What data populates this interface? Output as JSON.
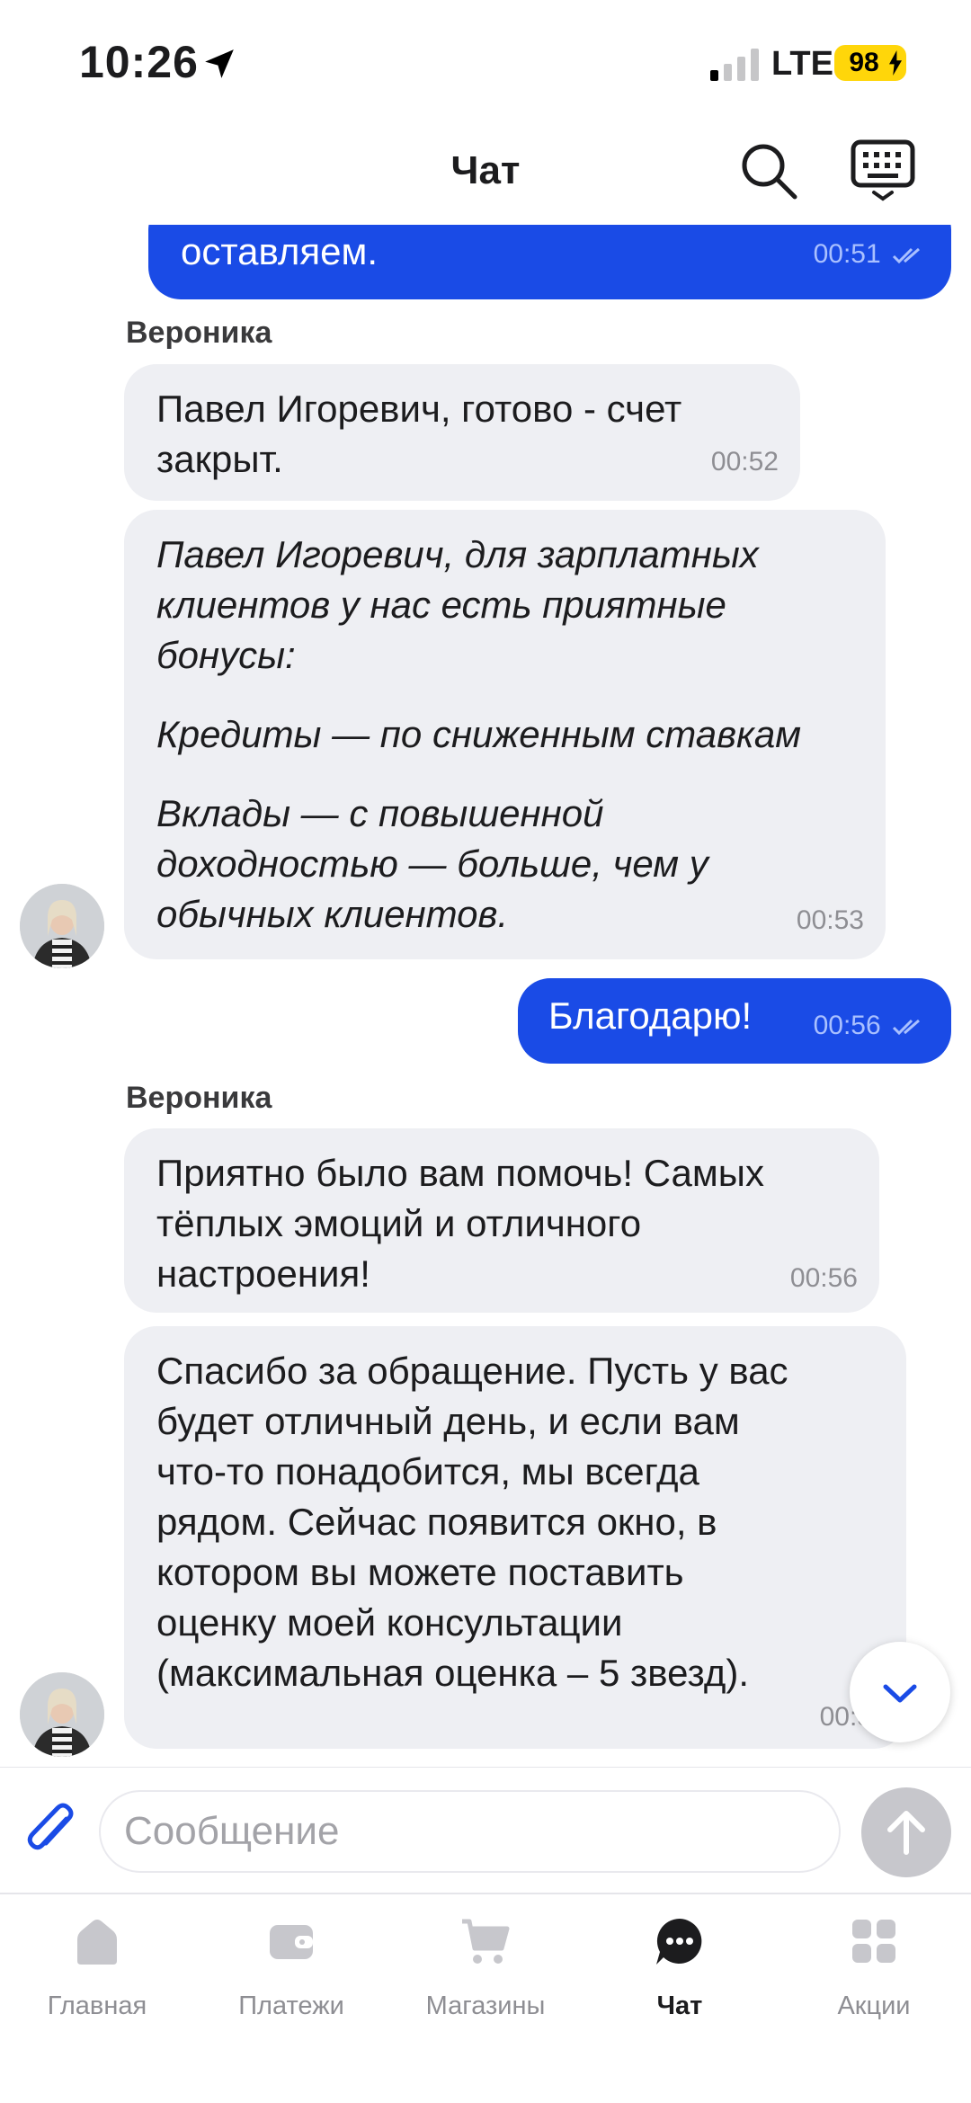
{
  "status_bar": {
    "time": "10:26",
    "network": "LTE",
    "battery": "98"
  },
  "header": {
    "title": "Чат"
  },
  "messages": [
    {
      "direction": "out",
      "text": "оставляем.",
      "time": "00:51"
    },
    {
      "direction": "in",
      "sender": "Вероника",
      "text": "Павел Игоревич, готово - счет\nзакрыт.",
      "time": "00:52"
    },
    {
      "direction": "in",
      "text": "Павел Игоревич, для зарплатных\nклиентов у нас есть приятные\nбонусы:",
      "paragraph2": "Кредиты — по сниженным ставкам",
      "paragraph3": "Вклады — с повышенной\nдоходностью — больше, чем у\nобычных клиентов.",
      "time": "00:53"
    },
    {
      "direction": "out",
      "text": "Благодарю!",
      "time": "00:56"
    },
    {
      "direction": "in",
      "sender": "Вероника",
      "text": "Приятно было вам помочь! Самых\nтёплых эмоций и отличного\nнастроения!",
      "time": "00:56"
    },
    {
      "direction": "in",
      "text": "Спасибо за обращение. Пусть у вас\nбудет отличный день, и если вам\nчто-то понадобится, мы всегда\nрядом. Сейчас появится окно, в\nкотором вы можете поставить\nоценку моей консультации\n(максимальная оценка – 5 звезд).",
      "time": "00:5"
    }
  ],
  "composer": {
    "placeholder": "Сообщение"
  },
  "tabs": [
    {
      "label": "Главная",
      "icon": "home-icon",
      "active": false
    },
    {
      "label": "Платежи",
      "icon": "wallet-icon",
      "active": false
    },
    {
      "label": "Магазины",
      "icon": "cart-icon",
      "active": false
    },
    {
      "label": "Чат",
      "icon": "chat-icon",
      "active": true
    },
    {
      "label": "Акции",
      "icon": "grid-icon",
      "active": false
    }
  ],
  "colors": {
    "accent": "#1a4be6",
    "incoming_bubble": "#eeeff3",
    "battery": "#ffd60a",
    "icon_gray": "#c7c7cc"
  }
}
